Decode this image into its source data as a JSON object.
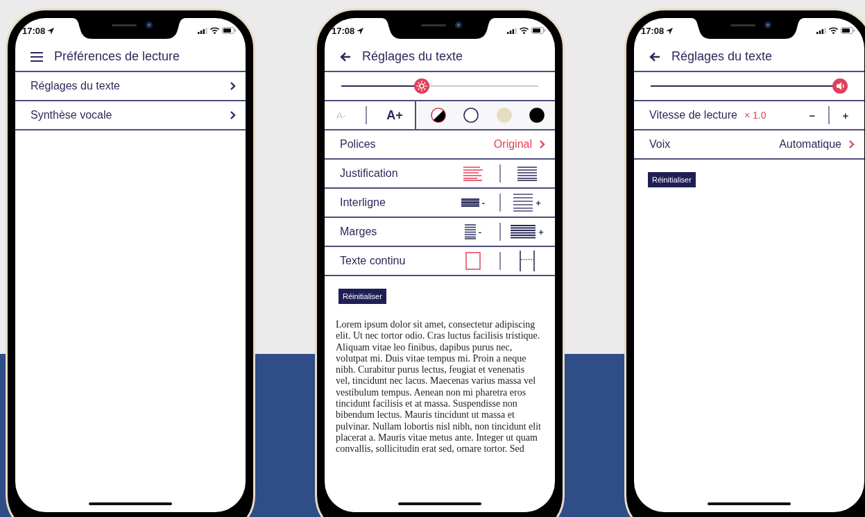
{
  "screens": [
    {
      "kind": "menu",
      "time": "17:08",
      "header": {
        "kind": "menu",
        "title": "Préférences de lecture"
      },
      "items": [
        {
          "label": "Réglages du texte"
        },
        {
          "label": "Synthèse vocale"
        }
      ]
    },
    {
      "kind": "text_settings",
      "time": "17:08",
      "header": {
        "kind": "back",
        "title": "Réglages du texte"
      },
      "slider": {
        "kind": "brightness",
        "level": 0.4
      },
      "font_size": [
        {
          "label": "A-",
          "disabled": true
        },
        {
          "label": "A+",
          "disabled": false
        }
      ],
      "themes": [
        {
          "kind": "contrast",
          "selected": true
        },
        {
          "kind": "solid",
          "color": "#ffffff",
          "selected": false
        },
        {
          "kind": "solid",
          "color": "#e8dcc0",
          "selected": false
        },
        {
          "kind": "solid",
          "color": "#000000",
          "selected": false
        }
      ],
      "font": {
        "label": "Polices",
        "value": "Original"
      },
      "options": [
        {
          "label": "Justification",
          "choices": [
            {
              "kind": "ragged",
              "selected": true
            },
            {
              "kind": "justified",
              "selected": false
            }
          ]
        },
        {
          "label": "Interligne",
          "choices": [
            {
              "kind": "tight",
              "mark": "-",
              "selected": false
            },
            {
              "kind": "loose",
              "mark": "+",
              "selected": false
            }
          ]
        },
        {
          "label": "Marges",
          "choices": [
            {
              "kind": "narrow",
              "mark": "-",
              "selected": false
            },
            {
              "kind": "wide",
              "mark": "+",
              "selected": false
            }
          ]
        },
        {
          "label": "Texte continu",
          "choices": [
            {
              "kind": "page",
              "selected": true
            },
            {
              "kind": "scroll",
              "selected": false
            }
          ]
        }
      ],
      "reset": "Réinitialiser",
      "preview": "Lorem ipsum dolor sit amet, consectetur adipiscing elit. Ut nec tortor odio. Cras luctus facilisis tristique. Aliquam vitae leo finibus, dapibus purus nec, volutpat mi. Duis vitae tempus mi. Proin a neque nibh. Curabitur purus lectus, feugiat et venenatis vel, tincidunt nec lacus. Maecenas varius massa vel vestibulum tempus. Aenean non mi pharetra eros tincidunt facilisis et at massa. Suspendisse non bibendum lectus. Mauris tincidunt ut massa et pulvinar. Nullam lobortis nisl nibh, non tincidunt elit placerat a. Mauris vitae metus ante. Integer ut quam convallis, sollicitudin erat sed, ornare tortor. Sed"
    },
    {
      "kind": "speech",
      "time": "17:08",
      "header": {
        "kind": "back",
        "title": "Réglages du texte"
      },
      "slider": {
        "kind": "volume",
        "level": 1.0
      },
      "speed": {
        "label": "Vitesse de lecture",
        "value": "× 1.0",
        "minus": "−",
        "plus": "+"
      },
      "voice": {
        "label": "Voix",
        "value": "Automatique"
      },
      "reset": "Réinitialiser"
    }
  ]
}
